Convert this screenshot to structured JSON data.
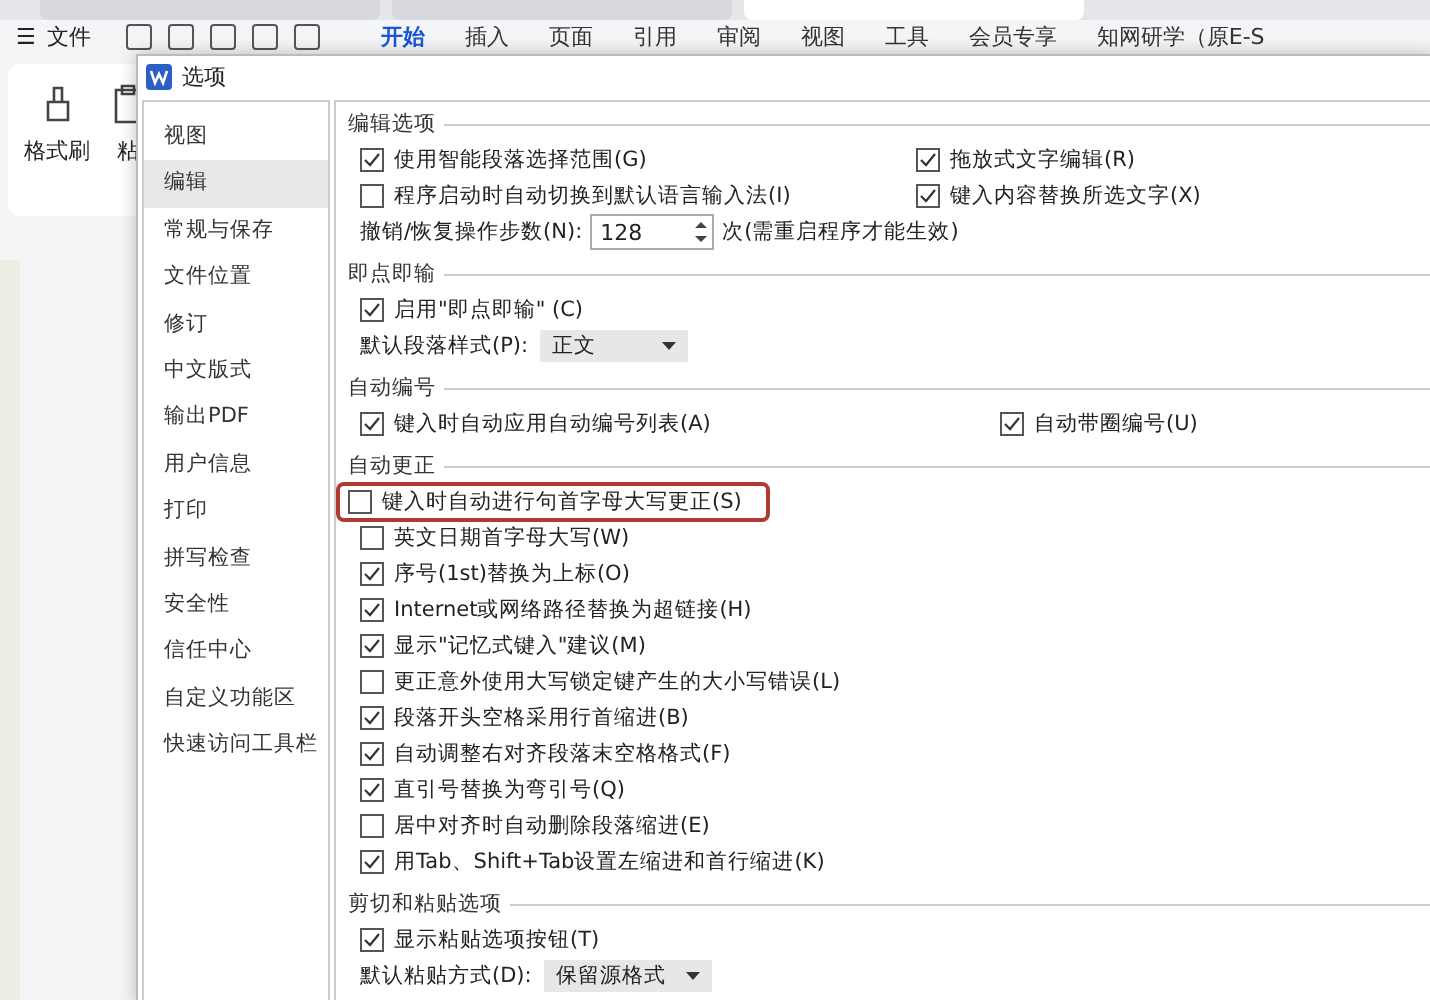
{
  "app": {
    "browser_tabs": [
      {
        "selected": false
      },
      {
        "selected": false
      },
      {
        "selected": true
      }
    ],
    "menu_icon": "☰",
    "file_menu": "文件",
    "ribbon_tabs": [
      {
        "label": "开始",
        "selected": true
      },
      {
        "label": "插入",
        "selected": false
      },
      {
        "label": "页面",
        "selected": false
      },
      {
        "label": "引用",
        "selected": false
      },
      {
        "label": "审阅",
        "selected": false
      },
      {
        "label": "视图",
        "selected": false
      },
      {
        "label": "工具",
        "selected": false
      },
      {
        "label": "会员专享",
        "selected": false
      },
      {
        "label": "知网研学（原E-S",
        "selected": false
      }
    ],
    "ribbon_buttons": [
      "格式刷",
      "粘"
    ]
  },
  "dialog": {
    "title": "选项",
    "sidebar": {
      "items": [
        {
          "label": "视图",
          "selected": false
        },
        {
          "label": "编辑",
          "selected": true
        },
        {
          "label": "常规与保存",
          "selected": false
        },
        {
          "label": "文件位置",
          "selected": false
        },
        {
          "label": "修订",
          "selected": false
        },
        {
          "label": "中文版式",
          "selected": false
        },
        {
          "label": "输出PDF",
          "selected": false
        },
        {
          "label": "用户信息",
          "selected": false
        },
        {
          "label": "打印",
          "selected": false
        },
        {
          "label": "拼写检查",
          "selected": false
        },
        {
          "label": "安全性",
          "selected": false
        },
        {
          "label": "信任中心",
          "selected": false
        },
        {
          "label": "自定义功能区",
          "selected": false
        },
        {
          "label": "快速访问工具栏",
          "selected": false
        }
      ]
    },
    "sections": [
      {
        "title": "编辑选项",
        "rows": [
          {
            "kind": "checkbox",
            "label": "使用智能段落选择范围(G)",
            "checked": true,
            "highlighted": false,
            "right": {
              "label": "拖放式文字编辑(R)",
              "checked": true
            }
          },
          {
            "kind": "checkbox",
            "label": "程序启动时自动切换到默认语言输入法(I)",
            "checked": false,
            "highlighted": false,
            "right": {
              "label": "键入内容替换所选文字(X)",
              "checked": true
            }
          },
          {
            "kind": "spin",
            "label": "撤销/恢复操作步数(N):",
            "value": "128",
            "note": "次(需重启程序才能生效)"
          }
        ]
      },
      {
        "title": "即点即输",
        "rows": [
          {
            "kind": "checkbox",
            "label": "启用\"即点即输\" (C)",
            "checked": true,
            "highlighted": false
          },
          {
            "kind": "select",
            "label": "默认段落样式(P):",
            "value": "正文"
          }
        ]
      },
      {
        "title": "自动编号",
        "rows": [
          {
            "kind": "checkbox",
            "label": "键入时自动应用自动编号列表(A)",
            "checked": true,
            "highlighted": false,
            "right": {
              "label": "自动带圈编号(U)",
              "checked": true
            }
          }
        ]
      },
      {
        "title": "自动更正",
        "rows": [
          {
            "kind": "checkbox",
            "label": "键入时自动进行句首字母大写更正(S)",
            "checked": false,
            "highlighted": true
          },
          {
            "kind": "checkbox",
            "label": "英文日期首字母大写(W)",
            "checked": false,
            "highlighted": false
          },
          {
            "kind": "checkbox",
            "label": "序号(1st)替换为上标(O)",
            "checked": true,
            "highlighted": false
          },
          {
            "kind": "checkbox",
            "label": "Internet或网络路径替换为超链接(H)",
            "checked": true,
            "highlighted": false
          },
          {
            "kind": "checkbox",
            "label": "显示\"记忆式键入\"建议(M)",
            "checked": true,
            "highlighted": false
          },
          {
            "kind": "checkbox",
            "label": "更正意外使用大写锁定键产生的大小写错误(L)",
            "checked": false,
            "highlighted": false
          },
          {
            "kind": "checkbox",
            "label": "段落开头空格采用行首缩进(B)",
            "checked": true,
            "highlighted": false
          },
          {
            "kind": "checkbox",
            "label": "自动调整右对齐段落末空格格式(F)",
            "checked": true,
            "highlighted": false
          },
          {
            "kind": "checkbox",
            "label": "直引号替换为弯引号(Q)",
            "checked": true,
            "highlighted": false
          },
          {
            "kind": "checkbox",
            "label": "居中对齐时自动删除段落缩进(E)",
            "checked": false,
            "highlighted": false
          },
          {
            "kind": "checkbox",
            "label": "用Tab、Shift+Tab设置左缩进和首行缩进(K)",
            "checked": true,
            "highlighted": false
          }
        ]
      },
      {
        "title": "剪切和粘贴选项",
        "rows": [
          {
            "kind": "checkbox",
            "label": "显示粘贴选项按钮(T)",
            "checked": true,
            "highlighted": false
          },
          {
            "kind": "select",
            "label": "默认粘贴方式(D):",
            "value": "保留源格式"
          }
        ]
      }
    ]
  }
}
